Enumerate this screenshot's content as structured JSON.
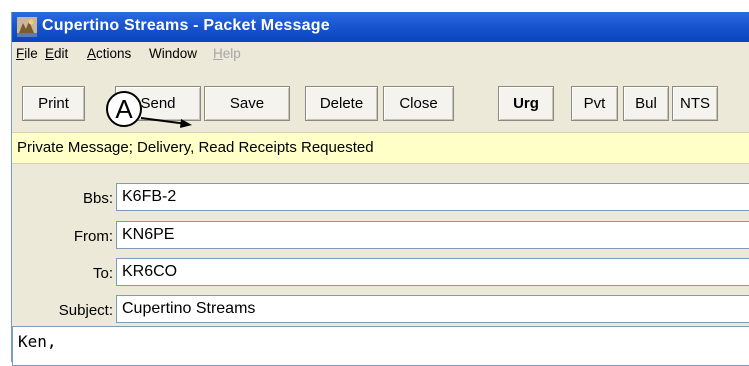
{
  "window": {
    "title": "Cupertino Streams - Packet Message"
  },
  "menu": {
    "file": {
      "accel": "F",
      "rest": "ile"
    },
    "edit": {
      "accel": "E",
      "rest": "dit"
    },
    "actions": {
      "accel": "A",
      "rest": "ctions"
    },
    "window": {
      "label": "Window"
    },
    "help": {
      "accel": "H",
      "rest": "elp"
    }
  },
  "toolbar": {
    "print": "Print",
    "send": "Send",
    "save": "Save",
    "delete": "Delete",
    "close": "Close",
    "urg": "Urg",
    "pvt": "Pvt",
    "bul": "Bul",
    "nts": "NTS"
  },
  "status": {
    "text": "Private Message;  Delivery, Read Receipts Requested"
  },
  "fields": {
    "bbs": {
      "label": "Bbs:",
      "value": "K6FB-2"
    },
    "from": {
      "label": "From:",
      "value": "KN6PE"
    },
    "to": {
      "label": "To:",
      "value": "KR6CO"
    },
    "subject": {
      "label": "Subject:",
      "value": "Cupertino Streams"
    }
  },
  "body": {
    "first_line": "Ken,"
  },
  "annotation": {
    "label": "A"
  },
  "colors": {
    "titlebar": "#0a44bf",
    "status_bg": "#ffffc8",
    "window_bg": "#ece9d8"
  },
  "icons": {
    "app": "app-icon"
  }
}
